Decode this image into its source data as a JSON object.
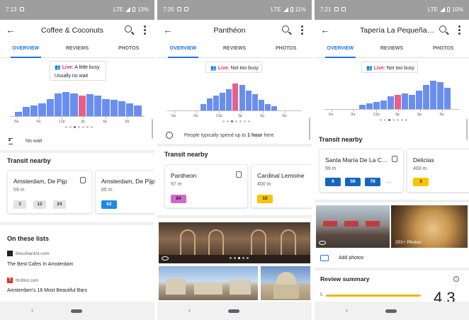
{
  "screens": [
    {
      "status": {
        "time": "7:13",
        "network": "LTE",
        "battery": "13%"
      },
      "title": "Coffee & Coconuts",
      "tabs": [
        "OVERVIEW",
        "REVIEWS",
        "PHOTOS"
      ],
      "live": {
        "label": "Live",
        "text": ": A little busy",
        "sub": "Usually no wait"
      },
      "popular_times": {
        "hours": [
          "6a",
          "9a",
          "12p",
          "3p",
          "6p",
          "9p"
        ],
        "values": [
          8,
          16,
          18,
          22,
          30,
          40,
          42,
          40,
          36,
          38,
          36,
          30,
          28,
          26,
          22,
          18
        ],
        "now_index": 8
      },
      "info_row": "No wait",
      "transit": {
        "heading": "Transit nearby",
        "stops": [
          {
            "name": "Amsterdam, De Pijp",
            "distance": "59 m",
            "routes": [
              "3",
              "12",
              "24"
            ]
          },
          {
            "name": "Amsterdam, De Pijp",
            "distance": "65 m",
            "routes": [
              "62"
            ]
          }
        ]
      },
      "lists": {
        "heading": "On these lists",
        "items": [
          {
            "source": "theurbanlist.com",
            "title": "The Best Cafes In Amsterdam"
          },
          {
            "source": "thrillist.com",
            "title": "Amsterdam's 16 Most Beautiful Bars"
          }
        ]
      }
    },
    {
      "status": {
        "time": "7:20",
        "network": "LTE",
        "battery": "11%"
      },
      "title": "Panthéon",
      "tabs": [
        "OVERVIEW",
        "REVIEWS",
        "PHOTOS"
      ],
      "live": {
        "label": "Live",
        "text": ": Not too busy"
      },
      "popular_times": {
        "hours": [
          "6a",
          "9a",
          "12p",
          "3p",
          "6p",
          "9p"
        ],
        "values": [
          10,
          18,
          22,
          26,
          32,
          40,
          38,
          30,
          24,
          16,
          10,
          6
        ],
        "now_index": 5
      },
      "info_row_prefix": "People typically spend up to ",
      "info_row_bold": "1 hour",
      "info_row_suffix": " here",
      "transit": {
        "heading": "Transit nearby",
        "stops": [
          {
            "name": "Pantheon",
            "distance": "97 m",
            "routes": [
              "84"
            ]
          },
          {
            "name": "Cardinal Lemoine",
            "distance": "400 m",
            "routes": [
              "10"
            ]
          }
        ]
      }
    },
    {
      "status": {
        "time": "7:21",
        "network": "LTE",
        "battery": "10%"
      },
      "title": "Tapería La Pequeña…",
      "tabs": [
        "OVERVIEW",
        "REVIEWS",
        "PHOTOS"
      ],
      "live": {
        "label": "Live",
        "text": ": Not too busy"
      },
      "popular_times": {
        "hours": [
          "6a",
          "9a",
          "12p",
          "3p",
          "6p",
          "9p"
        ],
        "values": [
          6,
          8,
          10,
          12,
          18,
          20,
          22,
          20,
          26,
          34,
          40,
          38,
          30
        ],
        "now_index": 5
      },
      "transit": {
        "heading": "Transit nearby",
        "stops": [
          {
            "name": "Santa María De La C…",
            "distance": "99 m",
            "routes": [
              "6",
              "59",
              "78"
            ],
            "more": "…"
          },
          {
            "name": "Delicias",
            "distance": "400 m",
            "routes": [
              "3"
            ]
          }
        ]
      },
      "photos": {
        "second_label": "201+ Photos"
      },
      "add_photos": "Add photos",
      "review_summary": {
        "heading": "Review summary",
        "first_star": "5",
        "big_rating": "4.3"
      }
    }
  ],
  "colors": {
    "accent": "#1a73e8",
    "live": "#d93075",
    "bar": "#6a8ef0",
    "bar_now": "#e8608a"
  }
}
